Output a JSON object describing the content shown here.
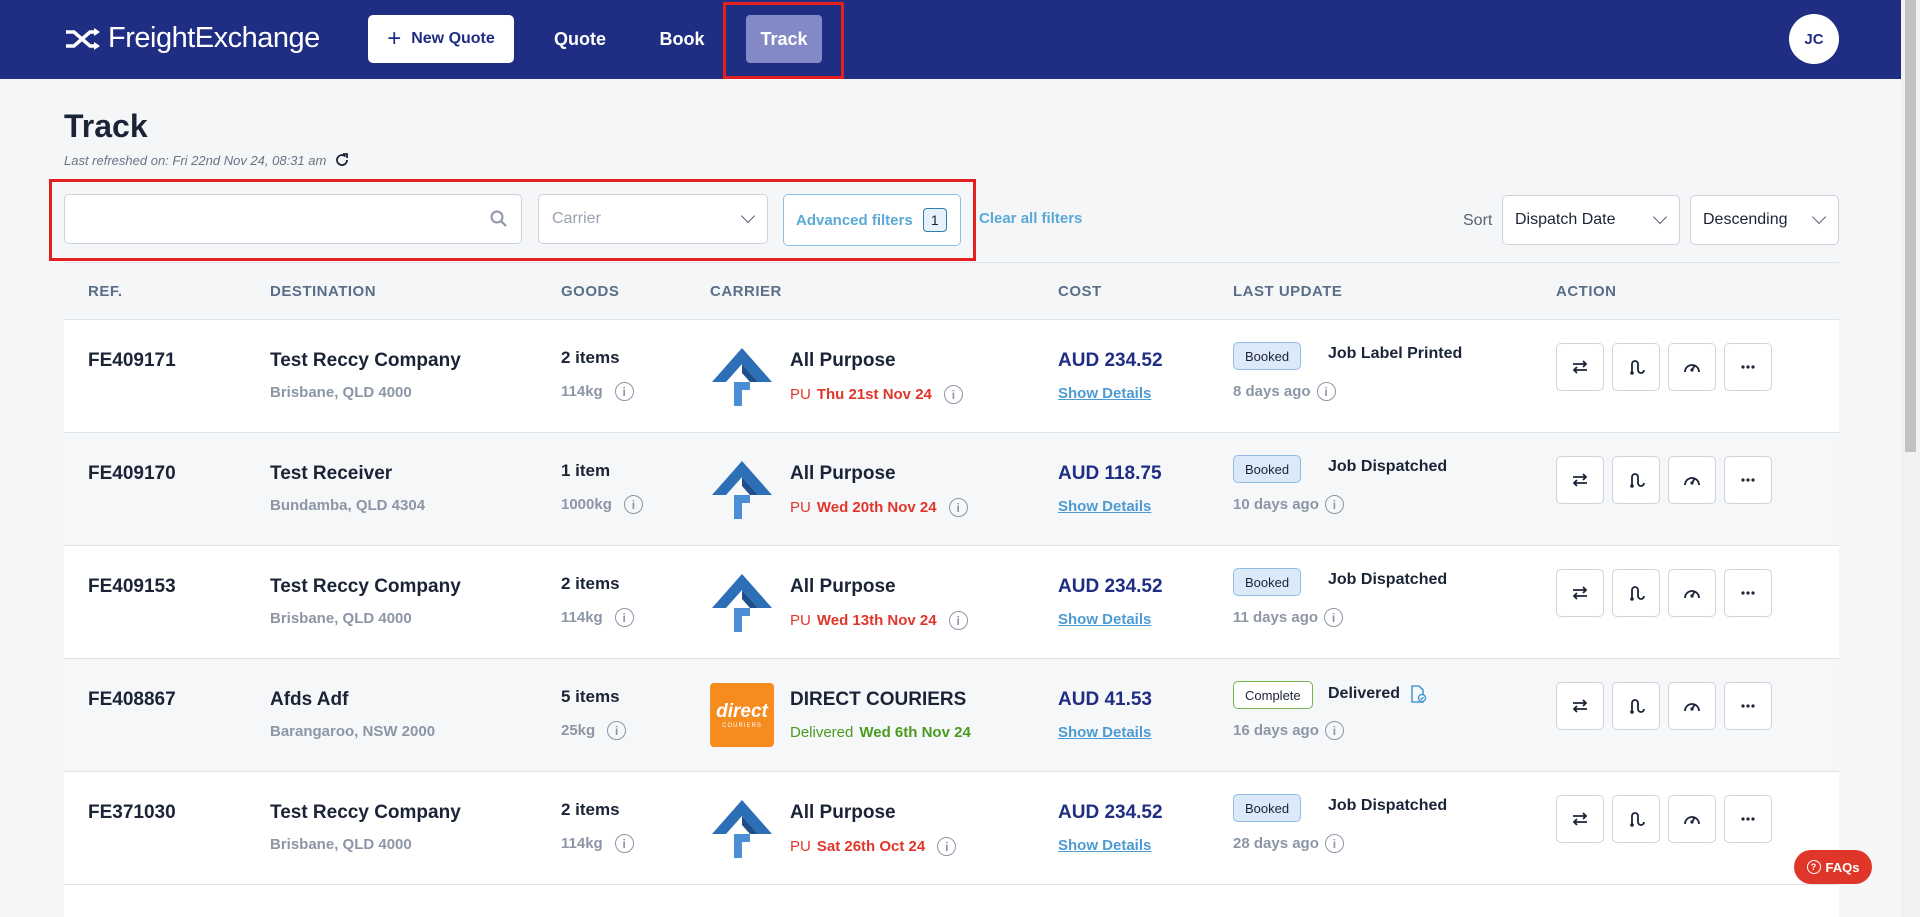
{
  "header": {
    "brand": "FreightExchange",
    "new_quote_label": "New Quote",
    "nav": [
      {
        "label": "Quote"
      },
      {
        "label": "Book"
      },
      {
        "label": "Track"
      }
    ],
    "avatar_initials": "JC"
  },
  "page": {
    "title": "Track",
    "last_refreshed": "Last refreshed on: Fri 22nd Nov 24, 08:31 am"
  },
  "filters": {
    "search_value": "",
    "carrier_placeholder": "Carrier",
    "advanced_label": "Advanced filters",
    "advanced_count": "1",
    "clear_label": "Clear all filters",
    "sort_label": "Sort",
    "sort_by": "Dispatch Date",
    "sort_dir": "Descending"
  },
  "table": {
    "columns": [
      "REF.",
      "DESTINATION",
      "GOODS",
      "CARRIER",
      "COST",
      "LAST UPDATE",
      "ACTION"
    ],
    "rows": [
      {
        "ref": "FE409171",
        "dest_name": "Test Reccy Company",
        "dest_addr": "Brisbane, QLD 4000",
        "goods_qty": "2 items",
        "goods_wt": "114kg",
        "carrier_name": "All Purpose",
        "carrier_logo": "all-purpose-logo",
        "date_prefix": "PU",
        "date": "Thu 21st Nov 24",
        "cost": "AUD 234.52",
        "details": "Show Details",
        "status": "Booked",
        "update": "Job Label Printed",
        "ago": "8 days ago"
      },
      {
        "ref": "FE409170",
        "dest_name": "Test Receiver",
        "dest_addr": "Bundamba, QLD 4304",
        "goods_qty": "1 item",
        "goods_wt": "1000kg",
        "carrier_name": "All Purpose",
        "carrier_logo": "all-purpose-logo",
        "date_prefix": "PU",
        "date": "Wed 20th Nov 24",
        "cost": "AUD 118.75",
        "details": "Show Details",
        "status": "Booked",
        "update": "Job Dispatched",
        "ago": "10 days ago"
      },
      {
        "ref": "FE409153",
        "dest_name": "Test Reccy Company",
        "dest_addr": "Brisbane, QLD 4000",
        "goods_qty": "2 items",
        "goods_wt": "114kg",
        "carrier_name": "All Purpose",
        "carrier_logo": "all-purpose-logo",
        "date_prefix": "PU",
        "date": "Wed 13th Nov 24",
        "cost": "AUD 234.52",
        "details": "Show Details",
        "status": "Booked",
        "update": "Job Dispatched",
        "ago": "11 days ago"
      },
      {
        "ref": "FE408867",
        "dest_name": "Afds Adf",
        "dest_addr": "Barangaroo, NSW 2000",
        "goods_qty": "5 items",
        "goods_wt": "25kg",
        "carrier_name": "DIRECT COURIERS",
        "carrier_logo": "direct-couriers-logo",
        "carrier_logo_text": "direct",
        "carrier_logo_subtext": "COURIERS",
        "date_prefix": "Delivered",
        "date": "Wed 6th Nov 24",
        "cost": "AUD 41.53",
        "details": "Show Details",
        "status": "Complete",
        "update": "Delivered",
        "ago": "16 days ago"
      },
      {
        "ref": "FE371030",
        "dest_name": "Test Reccy Company",
        "dest_addr": "Brisbane, QLD 4000",
        "goods_qty": "2 items",
        "goods_wt": "114kg",
        "carrier_name": "All Purpose",
        "carrier_logo": "all-purpose-logo",
        "date_prefix": "PU",
        "date": "Sat 26th Oct 24",
        "cost": "AUD 234.52",
        "details": "Show Details",
        "status": "Booked",
        "update": "Job Dispatched",
        "ago": "28 days ago"
      }
    ]
  },
  "faqs_label": "FAQs",
  "colors": {
    "header_bg": "#1f2d83",
    "active_tab": "#8389c6",
    "pickup_red": "#e0362a",
    "delivered_green": "#4b9a1e",
    "link_blue": "#4d9bd3",
    "highlight_red": "#e32020"
  }
}
